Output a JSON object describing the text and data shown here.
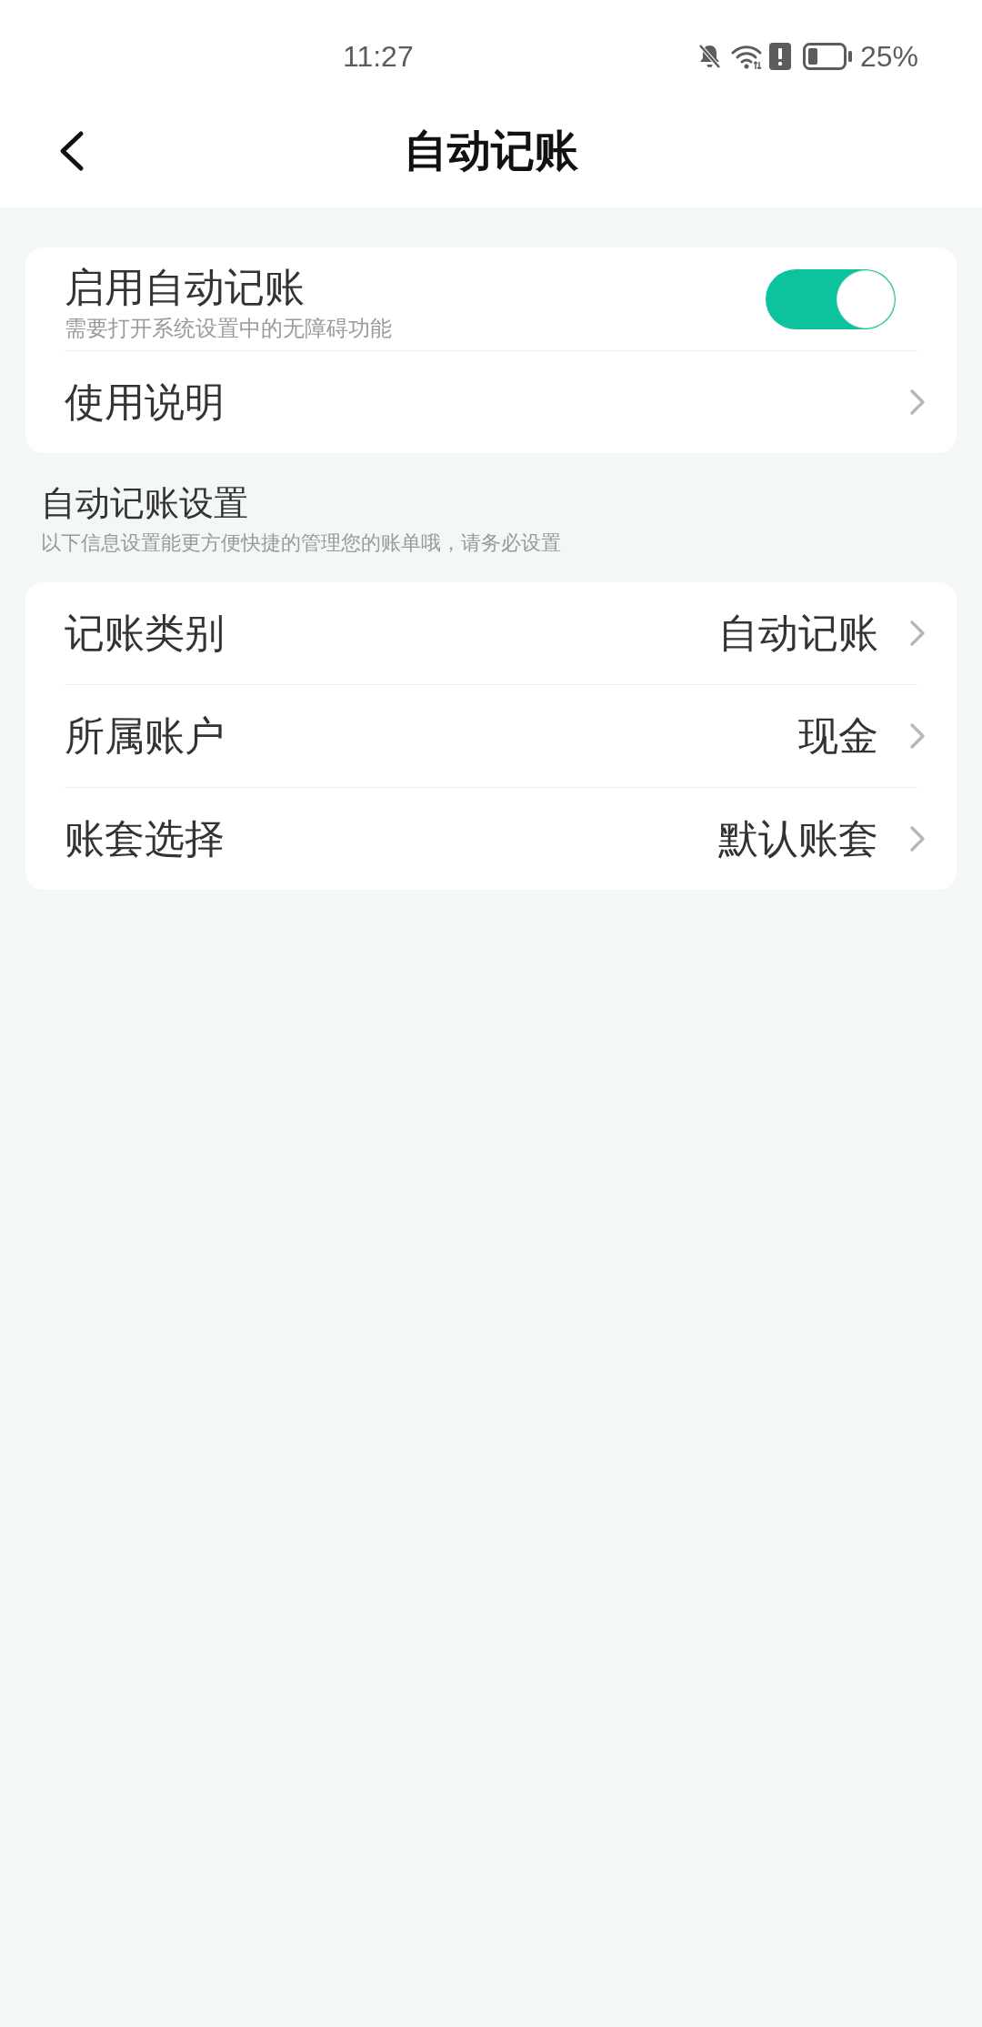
{
  "status_bar": {
    "time": "11:27",
    "battery": "25%"
  },
  "header": {
    "title": "自动记账"
  },
  "main_card": {
    "rows": [
      {
        "kind": "switch",
        "label": "启用自动记账",
        "hint": "需要打开系统设置中的无障碍功能",
        "on": true
      },
      {
        "kind": "link",
        "label": "使用说明"
      }
    ]
  },
  "settings_section": {
    "title": "自动记账设置",
    "subtitle": "以下信息设置能更方便快捷的管理您的账单哦，请务必设置",
    "rows": [
      {
        "kind": "value",
        "label": "记账类别",
        "value": "自动记账"
      },
      {
        "kind": "value",
        "label": "所属账户",
        "value": "现金"
      },
      {
        "kind": "value",
        "label": "账套选择",
        "value": "默认账套"
      }
    ]
  }
}
